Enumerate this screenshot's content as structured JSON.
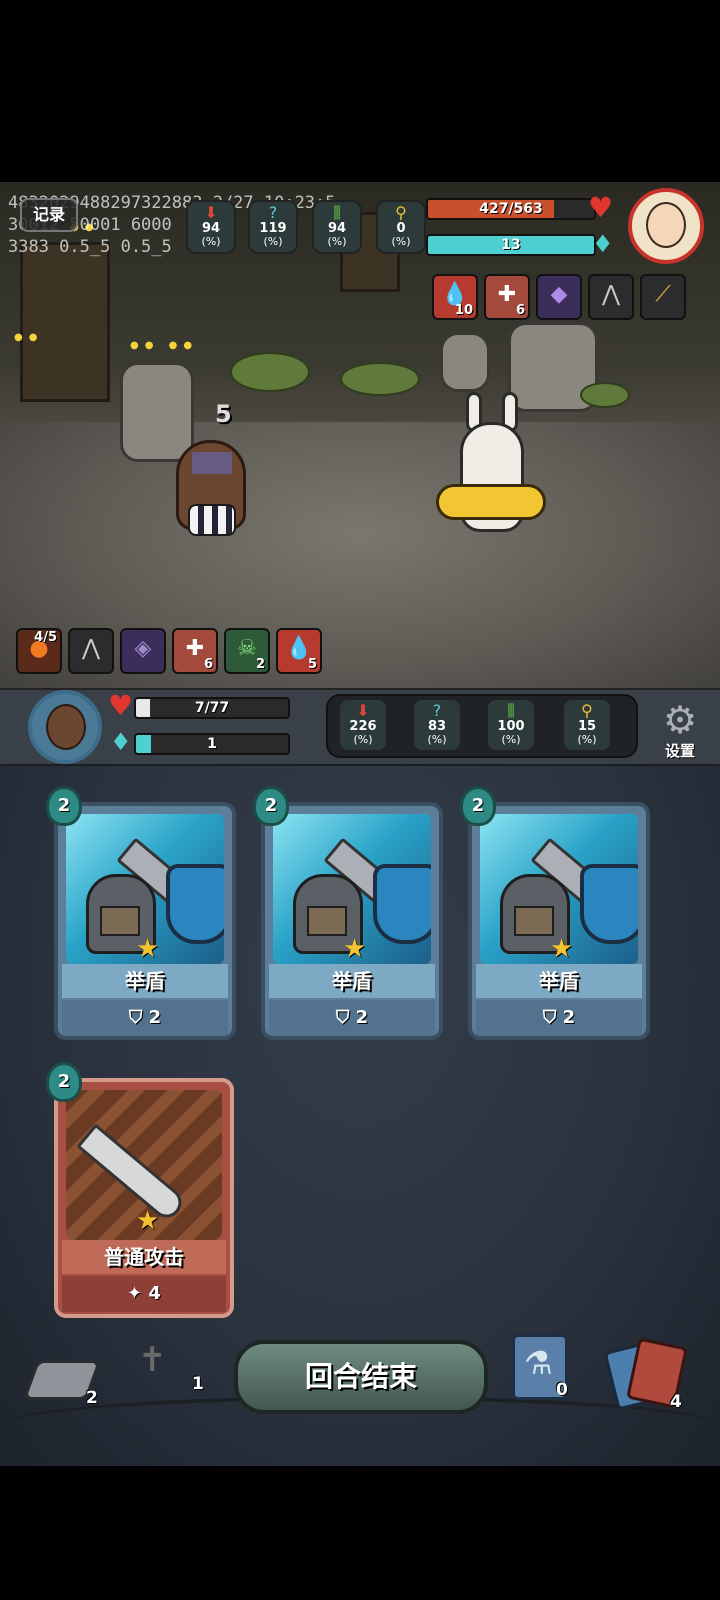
{
  "debug": {
    "line1": "4832029488297322883 2/27 10:23:5",
    "line2": "30012 50001 6000",
    "line3": "3383 0.5_5 0.5_5"
  },
  "record_button": "记录",
  "enemy": {
    "hp_text": "427/563",
    "hp_fraction": 0.758,
    "energy_text": "13",
    "energy_fraction": 1.0,
    "stats": [
      {
        "icon": "attack-icon",
        "value": "94",
        "unit": "(%)"
      },
      {
        "icon": "dodge-icon",
        "value": "119",
        "unit": "(%)"
      },
      {
        "icon": "defense-icon",
        "value": "94",
        "unit": "(%)"
      },
      {
        "icon": "crit-icon",
        "value": "0",
        "unit": "(%)"
      }
    ],
    "buffs": [
      {
        "icon": "bleed-icon",
        "count": "10"
      },
      {
        "icon": "bandage-icon",
        "count": "6"
      },
      {
        "icon": "spirit-crystal-icon",
        "count": ""
      },
      {
        "icon": "claw-trap-icon",
        "count": ""
      },
      {
        "icon": "horn-icon",
        "count": ""
      }
    ]
  },
  "player": {
    "hp_text": "7/77",
    "hp_fraction": 0.09,
    "energy_text": "1",
    "energy_fraction": 0.1,
    "stats": [
      {
        "icon": "attack-icon",
        "value": "226",
        "unit": "(%)"
      },
      {
        "icon": "dodge-icon",
        "value": "83",
        "unit": "(%)"
      },
      {
        "icon": "defense-icon",
        "value": "100",
        "unit": "(%)"
      },
      {
        "icon": "crit-icon",
        "value": "15",
        "unit": "(%)"
      }
    ],
    "buffs": [
      {
        "icon": "fire-orb-icon",
        "count": "4/5"
      },
      {
        "icon": "claw-trap-icon",
        "count": ""
      },
      {
        "icon": "crystal-icon",
        "count": ""
      },
      {
        "icon": "bandage-icon",
        "count": "6"
      },
      {
        "icon": "skull-icon",
        "count": "2"
      },
      {
        "icon": "bleed-icon",
        "count": "5"
      }
    ]
  },
  "hit_number": "5",
  "settings_label": "设置",
  "cards": [
    {
      "name": "举盾",
      "cost": "2",
      "effect_icon": "shield-icon",
      "effect_value": "2"
    },
    {
      "name": "举盾",
      "cost": "2",
      "effect_icon": "shield-icon",
      "effect_value": "2"
    },
    {
      "name": "举盾",
      "cost": "2",
      "effect_icon": "shield-icon",
      "effect_value": "2"
    },
    {
      "name": "普通攻击",
      "cost": "2",
      "effect_icon": "slash-icon",
      "effect_value": "4"
    }
  ],
  "bottom": {
    "draw_pile_count": "2",
    "grave_pile_count": "1",
    "end_turn_label": "回合结束",
    "potion_count": "0",
    "discard_pile_count": "4"
  },
  "colors": {
    "hp_red": "#c9502c",
    "energy_cyan": "#4fd0d0",
    "player_hp": "#e8e8e8"
  }
}
